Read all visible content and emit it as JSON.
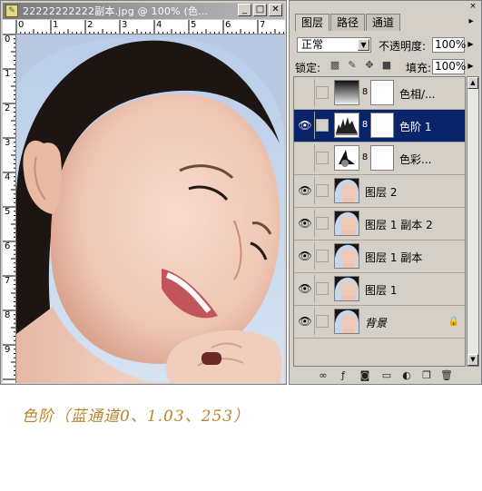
{
  "document_window": {
    "title": "22222222222副本.jpg @ 100% (色...",
    "buttons": {
      "minimize": "_",
      "maximize": "□",
      "close": "✕"
    },
    "ruler_top_marks": [
      "0",
      "1",
      "2",
      "3",
      "4",
      "5",
      "6",
      "7"
    ],
    "ruler_left_marks": [
      "0",
      "1",
      "2",
      "3",
      "4",
      "5",
      "6",
      "7",
      "8",
      "9"
    ]
  },
  "layers_panel": {
    "tabs": [
      "图层",
      "路径",
      "通道"
    ],
    "close": "×",
    "menu": "▸",
    "blend_mode": "正常",
    "opacity_label": "不透明度:",
    "opacity_value": "100%",
    "lock_label": "锁定:",
    "fill_label": "填充:",
    "fill_value": "100%",
    "layers": [
      {
        "name": "色相/...",
        "visible": false,
        "thumb": "hue-adjustment",
        "mask": true,
        "selected": false
      },
      {
        "name": "色阶 1",
        "visible": true,
        "thumb": "levels-adjustment",
        "mask": true,
        "selected": true
      },
      {
        "name": "色彩...",
        "visible": false,
        "thumb": "color-balance-adjustment",
        "mask": true,
        "selected": false
      },
      {
        "name": "图层 2",
        "visible": true,
        "thumb": "photo",
        "mask": false,
        "selected": false
      },
      {
        "name": "图层 1 副本 2",
        "visible": true,
        "thumb": "photo",
        "mask": false,
        "selected": false
      },
      {
        "name": "图层 1 副本",
        "visible": true,
        "thumb": "photo",
        "mask": false,
        "selected": false
      },
      {
        "name": "图层 1",
        "visible": true,
        "thumb": "photo",
        "mask": false,
        "selected": false
      },
      {
        "name": "背景",
        "visible": true,
        "thumb": "photo",
        "mask": false,
        "selected": false,
        "locked": true
      }
    ],
    "bottom_icons": [
      "link-layers-icon",
      "add-style-icon",
      "add-mask-icon",
      "new-group-icon",
      "new-adjustment-icon",
      "new-layer-icon",
      "delete-layer-icon"
    ]
  },
  "caption": "色阶（蓝通道0、1.03、253）"
}
